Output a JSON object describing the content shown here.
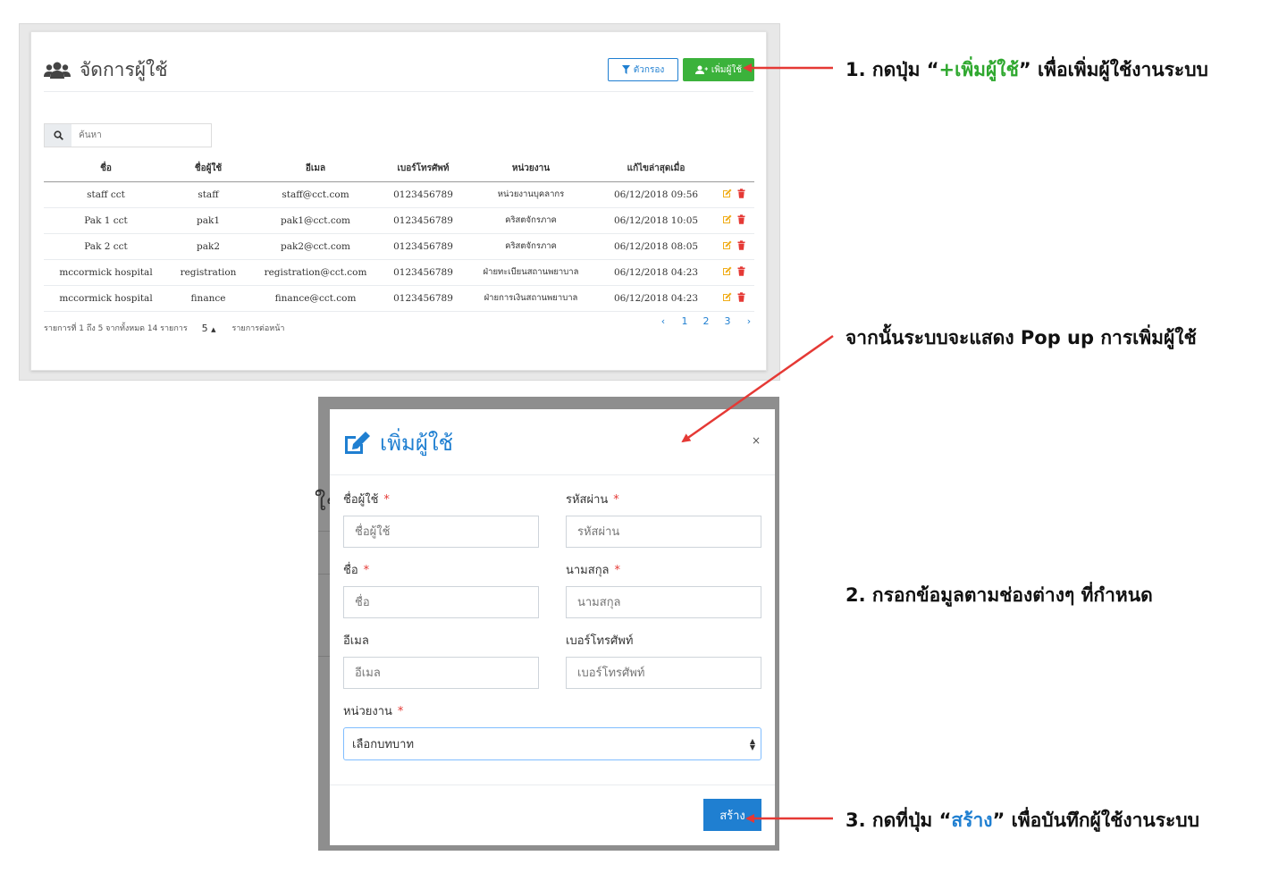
{
  "panel": {
    "title": "จัดการผู้ใช้",
    "filter_label": "ตัวกรอง",
    "add_user_label": "เพิ่มผู้ใช้",
    "search_placeholder": "ค้นหา",
    "columns": [
      "ชื่อ",
      "ชื่อผู้ใช้",
      "อีเมล",
      "เบอร์โทรศัพท์",
      "หน่วยงาน",
      "แก้ไขล่าสุดเมื่อ"
    ],
    "rows": [
      [
        "staff cct",
        "staff",
        "staff@cct.com",
        "0123456789",
        "หน่วยงานบุคลากร",
        "06/12/2018 09:56"
      ],
      [
        "Pak 1 cct",
        "pak1",
        "pak1@cct.com",
        "0123456789",
        "คริสตจักรภาค",
        "06/12/2018 10:05"
      ],
      [
        "Pak 2 cct",
        "pak2",
        "pak2@cct.com",
        "0123456789",
        "คริสตจักรภาค",
        "06/12/2018 08:05"
      ],
      [
        "mccormick hospital",
        "registration",
        "registration@cct.com",
        "0123456789",
        "ฝ่ายทะเบียนสถานพยาบาล",
        "06/12/2018 04:23"
      ],
      [
        "mccormick hospital",
        "finance",
        "finance@cct.com",
        "0123456789",
        "ฝ่ายการเงินสถานพยาบาล",
        "06/12/2018 04:23"
      ]
    ],
    "footer_info": "รายการที่ 1 ถึง 5 จากทั้งหมด 14 รายการ",
    "page_size": "5",
    "page_size_caret": "▲",
    "per_page_label": "รายการต่อหน้า",
    "pager": [
      "‹",
      "1",
      "2",
      "3",
      "›"
    ]
  },
  "modal": {
    "title": "เพิ่มผู้ใช้",
    "close": "×",
    "ghost_text": "ใช้",
    "fields": {
      "username": {
        "label": "ชื่อผู้ใช้",
        "placeholder": "ชื่อผู้ใช้",
        "required": "*"
      },
      "password": {
        "label": "รหัสผ่าน",
        "placeholder": "รหัสผ่าน",
        "required": "*"
      },
      "firstname": {
        "label": "ชื่อ",
        "placeholder": "ชื่อ",
        "required": "*"
      },
      "lastname": {
        "label": "นามสกุล",
        "placeholder": "นามสกุล",
        "required": "*"
      },
      "email": {
        "label": "อีเมล",
        "placeholder": "อีเมล"
      },
      "phone": {
        "label": "เบอร์โทรศัพท์",
        "placeholder": "เบอร์โทรศัพท์"
      },
      "department": {
        "label": "หน่วยงาน",
        "selected": "เลือกบทบาท",
        "required": "*"
      }
    },
    "create_label": "สร้าง"
  },
  "annotations": {
    "step1_prefix": "1. กดปุ่ม “",
    "step1_highlight": "+เพิ่มผู้ใช้",
    "step1_suffix": "” เพื่อเพิ่มผู้ใช้งานระบบ",
    "popup_note": "จากนั้นระบบจะแสดง Pop up การเพิ่มผู้ใช้",
    "step2": "2. กรอกข้อมูลตามช่องต่างๆ ที่กำหนด",
    "step3_prefix": "3. กดที่ปุ่ม “",
    "step3_highlight": "สร้าง",
    "step3_suffix": "” เพื่อบันทึกผู้ใช้งานระบบ"
  },
  "colors": {
    "primary": "#1f7fd1",
    "success": "#3bb23b",
    "danger": "#e53935",
    "edit": "#f0ad1a",
    "arrow": "#e53935"
  }
}
